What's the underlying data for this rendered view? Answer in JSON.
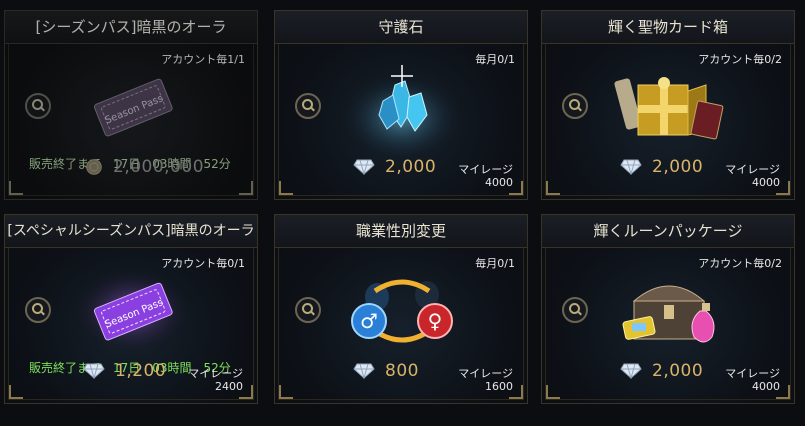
{
  "cards": [
    {
      "title": "[シーズンパス]暗黒のオーラ",
      "limit": "アカウント毎1/1",
      "timer": "販売終了まで　17日　03時間　52分",
      "price": "2,000,000",
      "currency_icon": "gold-coin-icon",
      "item_label": "Season Pass",
      "dimmed": true
    },
    {
      "title": "守護石",
      "limit": "毎月0/1",
      "price": "2,000",
      "currency_icon": "diamond-icon",
      "mileage_label": "マイレージ",
      "mileage_value": "4000"
    },
    {
      "title": "輝く聖物カード箱",
      "limit": "アカウント毎0/2",
      "price": "2,000",
      "currency_icon": "diamond-icon",
      "mileage_label": "マイレージ",
      "mileage_value": "4000"
    },
    {
      "title": "[スペシャルシーズンパス]暗黒のオーラ",
      "limit": "アカウント毎0/1",
      "timer": "販売終了まで　17日　03時間　52分",
      "price": "1,200",
      "currency_icon": "diamond-icon",
      "mileage_label": "マイレージ",
      "mileage_value": "2400",
      "item_label": "Season Pass"
    },
    {
      "title": "職業性別変更",
      "limit": "毎月0/1",
      "price": "800",
      "currency_icon": "diamond-icon",
      "mileage_label": "マイレージ",
      "mileage_value": "1600"
    },
    {
      "title": "輝くルーンパッケージ",
      "limit": "アカウント毎0/2",
      "price": "2,000",
      "currency_icon": "diamond-icon",
      "mileage_label": "マイレージ",
      "mileage_value": "4000"
    }
  ],
  "colors": {
    "price_gold": "#d8b46a",
    "timer_green": "#7fe05a",
    "frame_gold": "#8a7a4e"
  }
}
